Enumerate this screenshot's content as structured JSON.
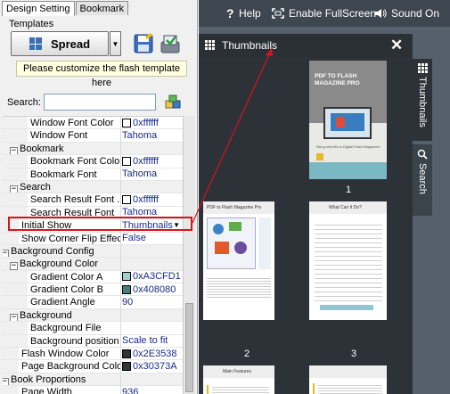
{
  "tabs": {
    "design": "Design Setting",
    "bookmark": "Bookmark"
  },
  "templates": {
    "label": "Templates",
    "selected": "Spread",
    "note": "Please customize the flash template here"
  },
  "search": {
    "label": "Search:",
    "value": ""
  },
  "properties": [
    {
      "label": "Window Font Color",
      "value": "0xffffff",
      "swatch": "#ffffff",
      "indent": 2
    },
    {
      "label": "Window Font",
      "value": "Tahoma",
      "indent": 2
    },
    {
      "label": "Bookmark",
      "category": true,
      "expanded": true,
      "indent": 1
    },
    {
      "label": "Bookmark Font Color",
      "value": "0xffffff",
      "swatch": "#ffffff",
      "indent": 2
    },
    {
      "label": "Bookmark Font",
      "value": "Tahoma",
      "indent": 2
    },
    {
      "label": "Search",
      "category": true,
      "expanded": true,
      "indent": 1
    },
    {
      "label": "Search Result Font ...",
      "value": "0xffffff",
      "swatch": "#ffffff",
      "indent": 2
    },
    {
      "label": "Search Result Font",
      "value": "Tahoma",
      "indent": 2
    },
    {
      "label": "Initial Show",
      "value": "Thumbnails",
      "indent": 1,
      "selected": true,
      "dropdown": true
    },
    {
      "label": "Show Corner Flip Effect",
      "value": "False",
      "indent": 1
    },
    {
      "label": "Background Config",
      "category": true,
      "expanded": true,
      "indent": 0
    },
    {
      "label": "Background Color",
      "category": true,
      "expanded": true,
      "indent": 1
    },
    {
      "label": "Gradient Color A",
      "value": "0xA3CFD1",
      "swatch": "#A3CFD1",
      "indent": 2
    },
    {
      "label": "Gradient Color B",
      "value": "0x408080",
      "swatch": "#408080",
      "indent": 2
    },
    {
      "label": "Gradient Angle",
      "value": "90",
      "indent": 2
    },
    {
      "label": "Background",
      "category": true,
      "expanded": true,
      "indent": 1
    },
    {
      "label": "Background File",
      "value": "",
      "indent": 2
    },
    {
      "label": "Background position",
      "value": "Scale to fit",
      "indent": 2
    },
    {
      "label": "Flash Window Color",
      "value": "0x2E3538",
      "swatch": "#2E3538",
      "indent": 1
    },
    {
      "label": "Page Background Color",
      "value": "0x30373A",
      "swatch": "#30373A",
      "indent": 1
    },
    {
      "label": "Book Proportions",
      "category": true,
      "expanded": true,
      "indent": 0
    },
    {
      "label": "Page Width",
      "value": "936",
      "indent": 1
    }
  ],
  "viewer": {
    "help": "Help",
    "fullscreen": "Enable FullScreen",
    "sound": "Sound On",
    "panel_title": "Thumbnails",
    "side_tabs": [
      "Thumbnails",
      "Search"
    ],
    "page_numbers": [
      "1",
      "2",
      "3"
    ],
    "page1": {
      "title": "PDF TO FLASH MAGAZINE PRO",
      "tagline": "Bring new life to Digital Flash Magazine!"
    },
    "page2": {
      "title": "PDF to Flash Magazine Pro"
    },
    "page3": {
      "title": "What Can It Do?"
    },
    "page4": {
      "title": "Main Features"
    }
  },
  "colors": {
    "accent_red": "#d8141b",
    "viewer_bg": "#55606c",
    "panel_bg": "#2c3238"
  }
}
